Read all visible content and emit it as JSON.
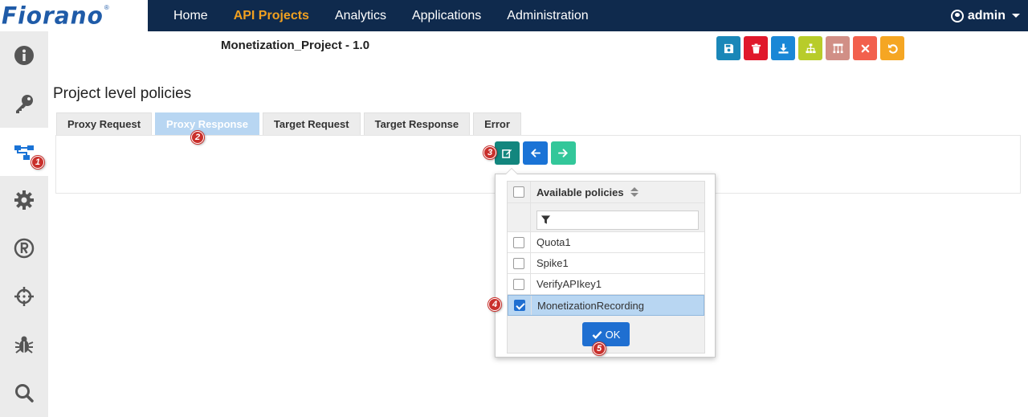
{
  "brand": {
    "logo_text": "Fiorano",
    "logo_mark": "®"
  },
  "nav": {
    "items": [
      {
        "label": "Home",
        "active": false
      },
      {
        "label": "API Projects",
        "active": true
      },
      {
        "label": "Analytics",
        "active": false
      },
      {
        "label": "Applications",
        "active": false
      },
      {
        "label": "Administration",
        "active": false
      }
    ],
    "user_label": "admin"
  },
  "sidebar": {
    "items": [
      {
        "icon": "info-icon",
        "active": false
      },
      {
        "icon": "key-icon",
        "active": false
      },
      {
        "icon": "policy-flow-icon",
        "active": true
      },
      {
        "icon": "gear-icon",
        "active": false
      },
      {
        "icon": "registered-icon",
        "active": false
      },
      {
        "icon": "crosshair-icon",
        "active": false
      },
      {
        "icon": "bug-icon",
        "active": false
      },
      {
        "icon": "search-icon",
        "active": false
      }
    ]
  },
  "project": {
    "title": "Monetization_Project - 1.0"
  },
  "toolbar": {
    "buttons": [
      {
        "icon": "save-icon",
        "color": "#1a87b8"
      },
      {
        "icon": "trash-icon",
        "color": "#e0182b"
      },
      {
        "icon": "download-icon",
        "color": "#1a87d6"
      },
      {
        "icon": "sitemap-icon",
        "color": "#b8cc2a"
      },
      {
        "icon": "hierarchy-icon",
        "color": "#d18f86"
      },
      {
        "icon": "close-icon",
        "color": "#f2604d"
      },
      {
        "icon": "undo-icon",
        "color": "#f5a623"
      }
    ]
  },
  "section": {
    "title": "Project level policies"
  },
  "tabs": [
    {
      "label": "Proxy Request",
      "active": false
    },
    {
      "label": "Proxy Response",
      "active": true
    },
    {
      "label": "Target Request",
      "active": false
    },
    {
      "label": "Target Response",
      "active": false
    },
    {
      "label": "Error",
      "active": false
    }
  ],
  "action_buttons": [
    {
      "icon": "edit-icon",
      "color": "#13867e"
    },
    {
      "icon": "arrow-left-icon",
      "color": "#1a73d6"
    },
    {
      "icon": "arrow-right-icon",
      "color": "#33c79a"
    }
  ],
  "policy_picker": {
    "header": "Available policies",
    "filter_placeholder": "",
    "policies": [
      {
        "name": "Quota1",
        "checked": false
      },
      {
        "name": "Spike1",
        "checked": false
      },
      {
        "name": "VerifyAPIkey1",
        "checked": false
      },
      {
        "name": "MonetizationRecording",
        "checked": true
      }
    ],
    "ok_label": "OK"
  },
  "callouts": [
    "1",
    "2",
    "3",
    "4",
    "5"
  ]
}
